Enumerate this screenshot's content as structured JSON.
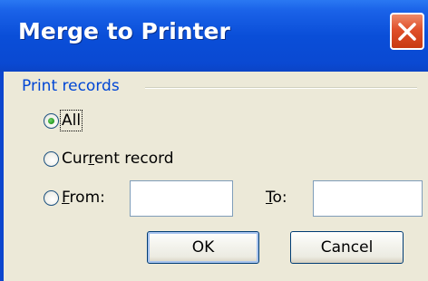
{
  "window": {
    "title": "Merge to Printer"
  },
  "group": {
    "label": "Print records"
  },
  "options": {
    "all": {
      "label": "All",
      "selected": true
    },
    "current": {
      "label_pre": "Cur",
      "label_access": "r",
      "label_post": "ent record",
      "selected": false
    },
    "from": {
      "label_access": "F",
      "label_post": "rom:",
      "selected": false
    }
  },
  "fields": {
    "from_value": "",
    "to_label_access": "T",
    "to_label_post": "o:",
    "to_value": ""
  },
  "buttons": {
    "ok": "OK",
    "cancel": "Cancel"
  },
  "colors": {
    "titlebar": "#0a4ed8",
    "close": "#e0502a",
    "client": "#ece9d8",
    "group_label": "#0046d5",
    "radio_dot": "#2fa12a"
  },
  "icons": {
    "close": "close-icon"
  }
}
